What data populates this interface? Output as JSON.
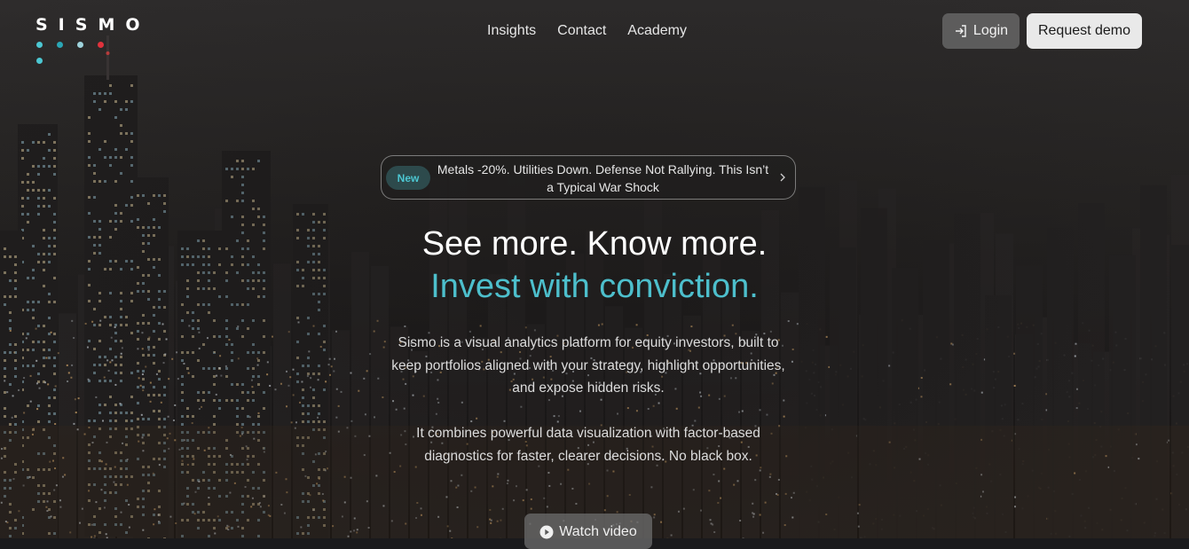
{
  "brand": {
    "logo_text": "SISMO",
    "dot_colors": [
      "#4cc7d2",
      "#2aa6b5",
      "#9fd3dc",
      "#e0323c",
      "#4cc7d2"
    ]
  },
  "nav": {
    "items": [
      {
        "label": "Insights"
      },
      {
        "label": "Contact"
      },
      {
        "label": "Academy"
      }
    ]
  },
  "header": {
    "login_label": "Login",
    "demo_label": "Request demo"
  },
  "announcement": {
    "badge": "New",
    "text": "Metals -20%. Utilities Down. Defense Not Rallying. This Isn’t a Typical War Shock"
  },
  "hero": {
    "headline_line1": "See more. Know more.",
    "headline_line2": "Invest with conviction.",
    "description_1": "Sismo is a visual analytics platform for equity investors, built to keep portfolios aligned with your strategy, highlight opportunities, and expose hidden risks.",
    "description_2": "It combines powerful data visualization with factor-based diagnostics for faster, clearer decisions. No black box.",
    "video_label": "Watch video"
  },
  "colors": {
    "accent": "#4dbfcc",
    "badge_bg": "#2d4a4c",
    "badge_text": "#4cc7d2"
  }
}
